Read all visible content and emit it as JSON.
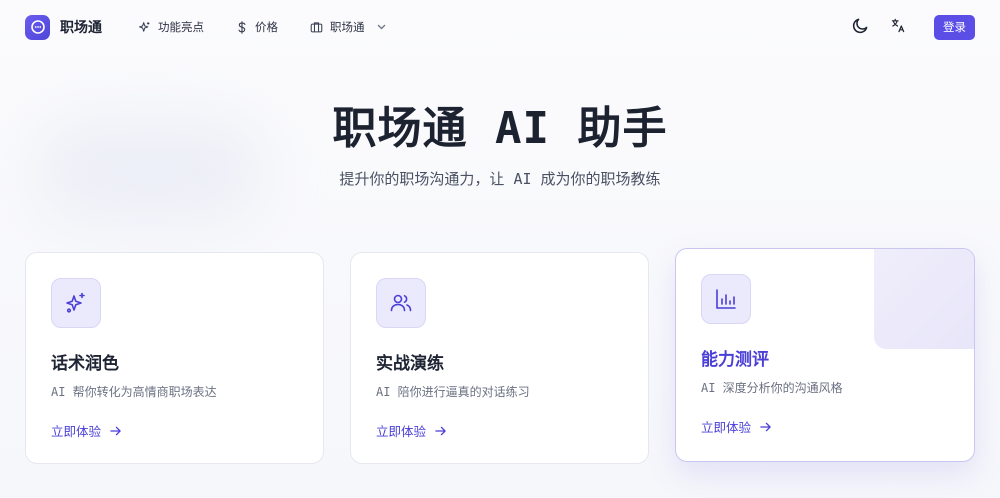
{
  "header": {
    "brand": "职场通",
    "nav": [
      {
        "label": "功能亮点",
        "icon": "sparkles-icon"
      },
      {
        "label": "价格",
        "icon": "dollar-icon"
      },
      {
        "label": "职场通",
        "icon": "briefcase-icon"
      }
    ],
    "login_label": "登录"
  },
  "hero": {
    "title": "职场通 AI 助手",
    "subtitle": "提升你的职场沟通力，让 AI 成为你的职场教练"
  },
  "cards": [
    {
      "icon": "sparkles-icon",
      "title": "话术润色",
      "desc": "AI 帮你转化为高情商职场表达",
      "link": "立即体验"
    },
    {
      "icon": "users-icon",
      "title": "实战演练",
      "desc": "AI 陪你进行逼真的对话练习",
      "link": "立即体验"
    },
    {
      "icon": "bar-chart-icon",
      "title": "能力测评",
      "desc": "AI 深度分析你的沟通风格",
      "link": "立即体验"
    }
  ],
  "colors": {
    "accent": "#5b4ee6",
    "accent_text": "#4a3fd6"
  }
}
